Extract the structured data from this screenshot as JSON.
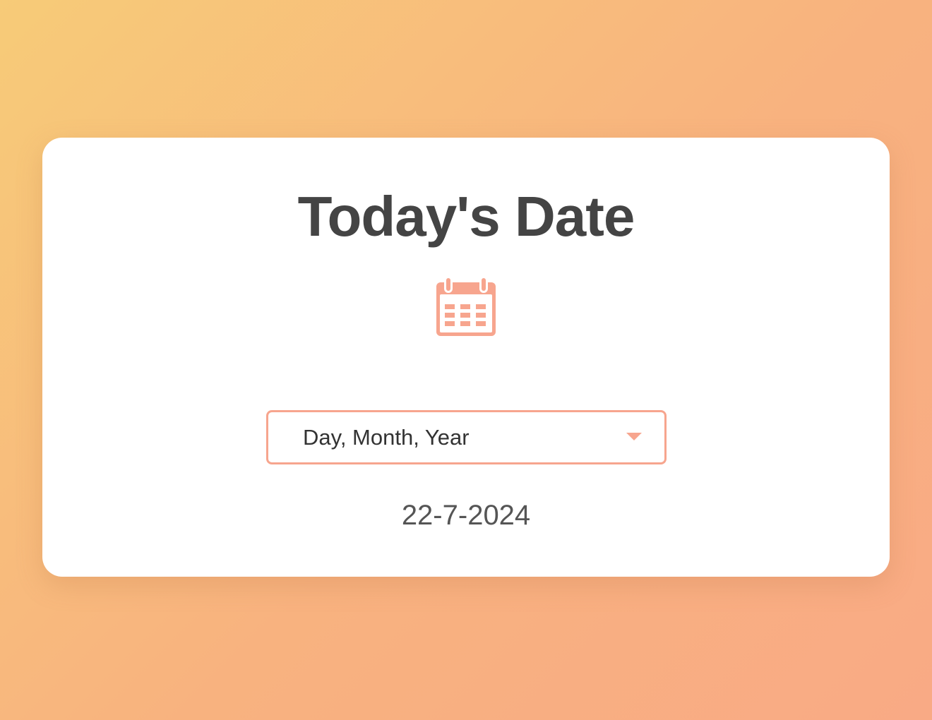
{
  "page": {
    "title": "Today's Date"
  },
  "calendar": {
    "icon": "calendar-icon",
    "color": "#f7a58e"
  },
  "format_select": {
    "selected": "Day, Month, Year",
    "accent": "#f7a58e"
  },
  "output": {
    "date": "22-7-2024"
  }
}
